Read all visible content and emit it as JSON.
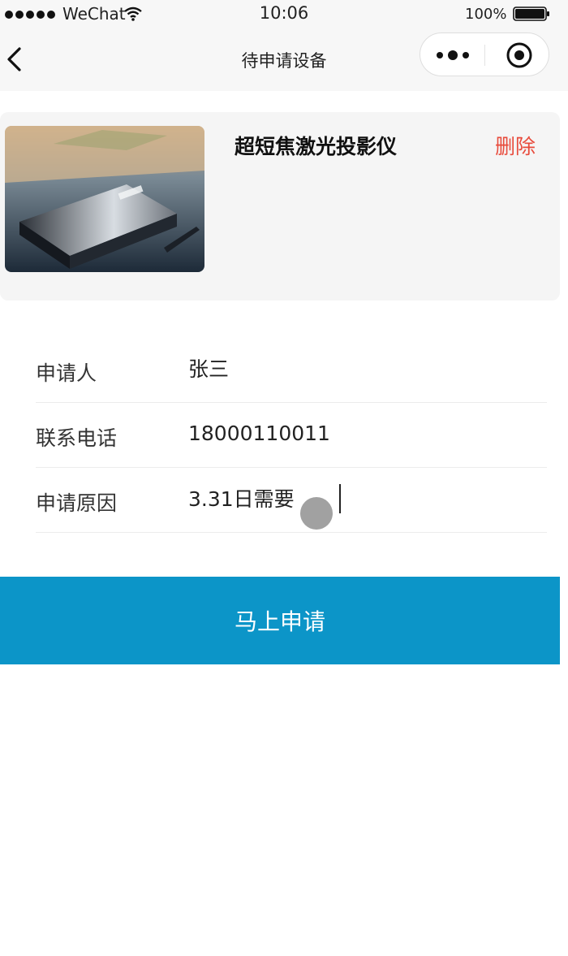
{
  "status_bar": {
    "carrier": "WeChat",
    "time": "10:06",
    "battery": "100%",
    "icons": [
      "signal-icon",
      "wifi-icon",
      "battery-icon"
    ]
  },
  "nav": {
    "title": "待申请设备",
    "icons": [
      "back-icon",
      "more-icon",
      "close-mini-program-icon"
    ]
  },
  "product": {
    "name": "超短焦激光投影仪",
    "delete_label": "删除",
    "image": "projector-photo"
  },
  "form": {
    "applicant_label": "申请人",
    "applicant_value": "张三",
    "phone_label": "联系电话",
    "phone_value": "18000110011",
    "reason_label": "申请原因",
    "reason_value": "3.31日需要"
  },
  "actions": {
    "apply_label": "马上申请"
  },
  "colors": {
    "accent": "#0c95c8",
    "danger": "#e84b3c",
    "card_bg": "#f5f5f5"
  }
}
